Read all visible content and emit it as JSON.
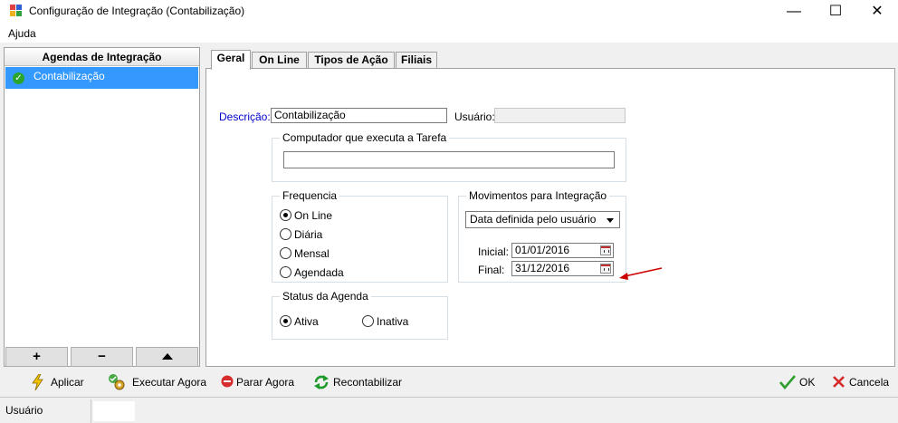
{
  "window": {
    "title": "Configuração de Integração (Contabilização)",
    "minimize": "—",
    "maximize": "☐",
    "close": "✕"
  },
  "menu": {
    "help": "Ajuda"
  },
  "left_panel": {
    "header": "Agendas de Integração",
    "items": [
      {
        "label": "Contabilização",
        "selected": true
      }
    ],
    "buttons": {
      "add": "+",
      "remove": "−"
    }
  },
  "tabs": [
    {
      "label": "Geral",
      "active": true
    },
    {
      "label": "On Line"
    },
    {
      "label": "Tipos de Ação"
    },
    {
      "label": "Filiais"
    }
  ],
  "general": {
    "description_label": "Descrição:",
    "description_value": "Contabilização",
    "user_label": "Usuário:",
    "user_value": "",
    "computer_group": "Computador que executa a Tarefa",
    "computer_value": "",
    "frequency_group": "Frequencia",
    "frequency_options": [
      {
        "label": "On Line",
        "checked": true
      },
      {
        "label": "Diária",
        "checked": false
      },
      {
        "label": "Mensal",
        "checked": false
      },
      {
        "label": "Agendada",
        "checked": false
      }
    ],
    "movements_group": "Movimentos para Integração",
    "movements_select": "Data definida pelo usuário",
    "initial_label": "Inicial:",
    "initial_value": "01/01/2016",
    "final_label": "Final:",
    "final_value": "31/12/2016",
    "status_group": "Status da Agenda",
    "status_options": [
      {
        "label": "Ativa",
        "checked": true
      },
      {
        "label": "Inativa",
        "checked": false
      }
    ]
  },
  "toolbar": {
    "apply": "Aplicar",
    "run_now": "Executar Agora",
    "stop_now": "Parar Agora",
    "recount": "Recontabilizar",
    "ok": "OK",
    "cancel": "Cancela"
  },
  "status_bar": {
    "user_label": "Usuário",
    "user_value": ""
  },
  "colors": {
    "selection": "#3399ff",
    "label_blue": "#0000cc",
    "annotation_arrow": "#cc0000"
  }
}
